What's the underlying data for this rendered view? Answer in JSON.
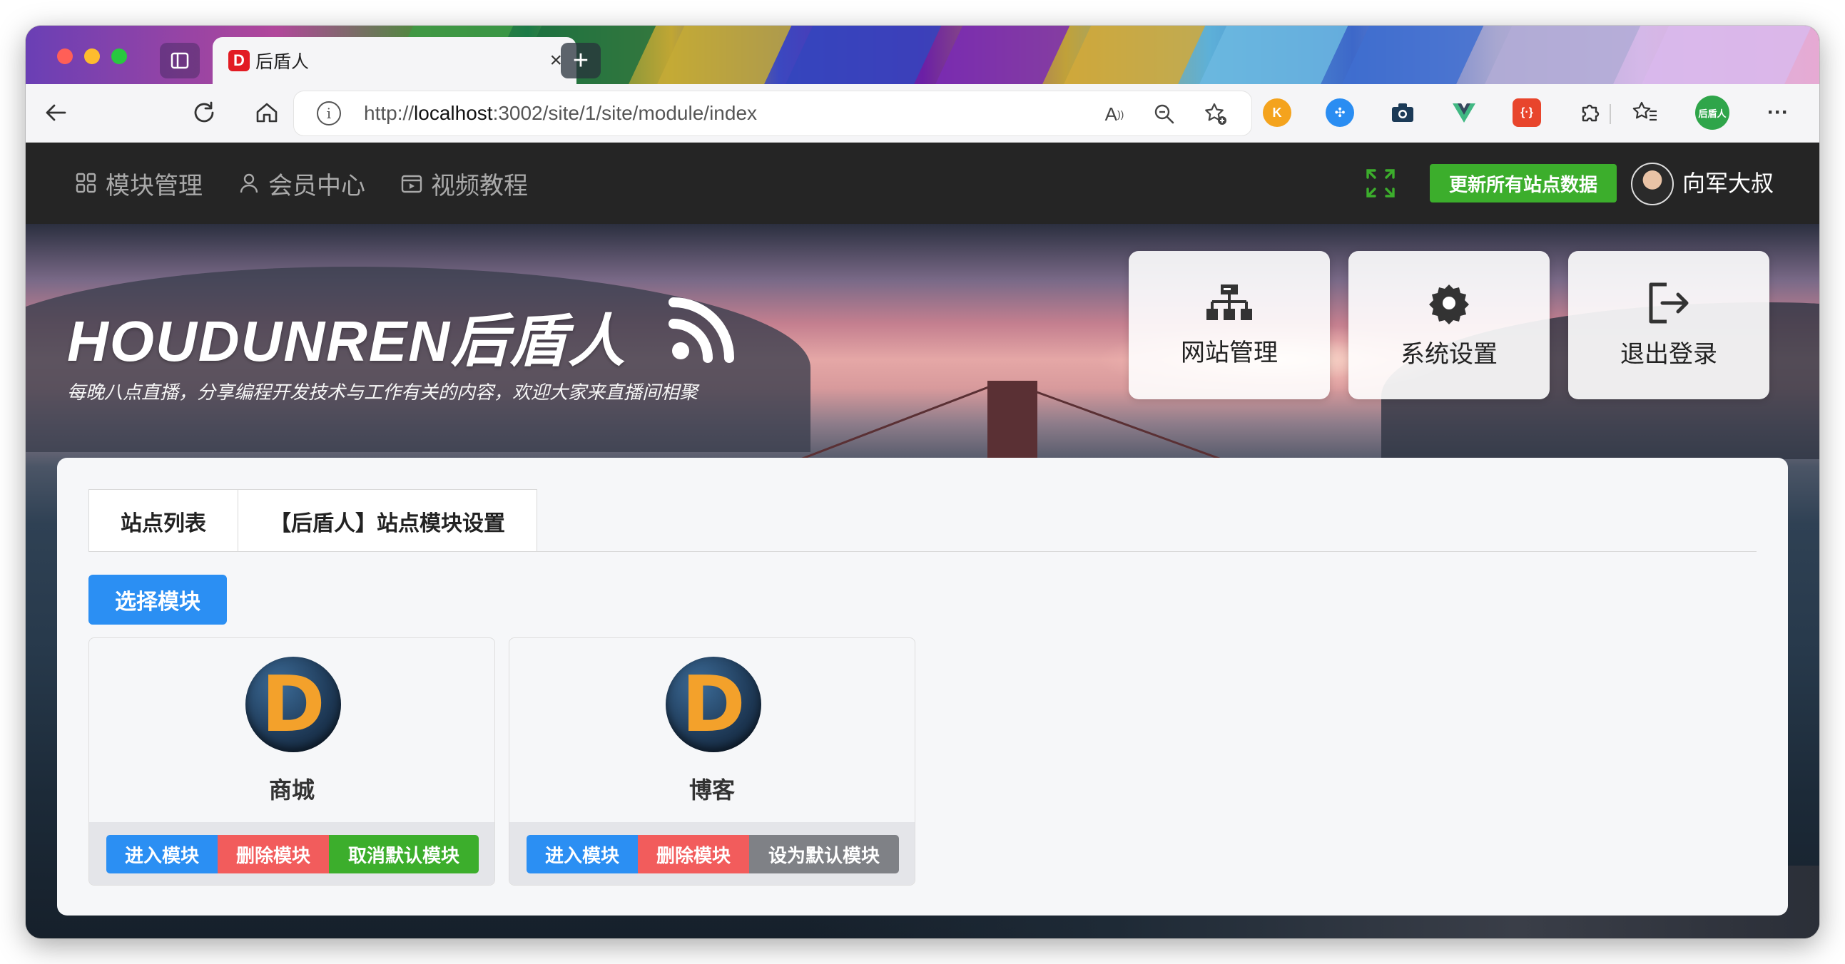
{
  "browser": {
    "tab_title": "后盾人",
    "favicon_letter": "D",
    "address": {
      "prefix": "http://",
      "host": "localhost",
      "rest": ":3002/site/1/site/module/index"
    },
    "profile_badge": "后盾人",
    "icons": [
      "back-icon",
      "forward-icon",
      "reload-icon",
      "home-icon",
      "info-icon",
      "read-aloud-icon",
      "zoom-out-icon",
      "add-favorite-icon",
      "extension-icons",
      "extensions-icon",
      "favorites-icon",
      "more-icon"
    ]
  },
  "header": {
    "menu": [
      {
        "label": "模块管理",
        "icon": "grid-icon"
      },
      {
        "label": "会员中心",
        "icon": "user-icon"
      },
      {
        "label": "视频教程",
        "icon": "video-icon"
      }
    ],
    "update_button": "更新所有站点数据",
    "user_name": "向军大叔"
  },
  "banner": {
    "brand": "HOUDUNREN后盾人",
    "slogan": "每晚八点直播，分享编程开发技术与工作有关的内容，欢迎大家来直播间相聚",
    "quick_links": [
      {
        "label": "网站管理",
        "icon": "sitemap-icon"
      },
      {
        "label": "系统设置",
        "icon": "gear-icon"
      },
      {
        "label": "退出登录",
        "icon": "logout-icon"
      }
    ]
  },
  "main": {
    "tabs": [
      "站点列表",
      "【后盾人】站点模块设置"
    ],
    "select_button": "选择模块",
    "modules": [
      {
        "logo": "D",
        "name": "商城",
        "enter": "进入模块",
        "delete": "删除模块",
        "default_action": "取消默认模块"
      },
      {
        "logo": "D",
        "name": "博客",
        "enter": "进入模块",
        "delete": "删除模块",
        "default_action": "设为默认模块"
      }
    ]
  },
  "colors": {
    "primary": "#2b8ff3",
    "danger": "#f25c5c",
    "success": "#3cae2c",
    "neutral": "#7f8186",
    "header_bg": "#252525"
  }
}
